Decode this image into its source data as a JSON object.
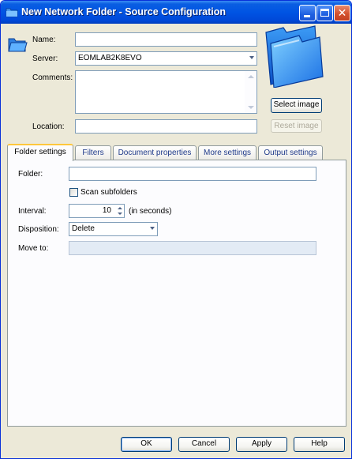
{
  "window": {
    "title": "New Network Folder - Source Configuration"
  },
  "form": {
    "name_label": "Name:",
    "name_value": "",
    "server_label": "Server:",
    "server_value": "EOMLAB2K8EVO",
    "comments_label": "Comments:",
    "comments_value": "",
    "location_label": "Location:",
    "location_value": ""
  },
  "image_panel": {
    "select_image_label": "Select image",
    "reset_image_label": "Reset image"
  },
  "tabs": [
    {
      "label": "Folder settings",
      "active": true
    },
    {
      "label": "Filters",
      "active": false
    },
    {
      "label": "Document properties",
      "active": false
    },
    {
      "label": "More settings",
      "active": false
    },
    {
      "label": "Output settings",
      "active": false
    }
  ],
  "folder_settings": {
    "folder_label": "Folder:",
    "folder_value": "",
    "scan_subfolders_label": "Scan subfolders",
    "scan_subfolders_checked": false,
    "interval_label": "Interval:",
    "interval_value": "10",
    "interval_unit": "(in seconds)",
    "disposition_label": "Disposition:",
    "disposition_value": "Delete",
    "move_to_label": "Move to:",
    "move_to_value": ""
  },
  "footer": {
    "ok_label": "OK",
    "cancel_label": "Cancel",
    "apply_label": "Apply",
    "help_label": "Help"
  },
  "colors": {
    "titlebar": "#0054e3",
    "dialog_bg": "#ece9d8",
    "active_tab_highlight": "#ffc73c"
  },
  "icons": {
    "window_icon": "network-folder-icon",
    "form_icon": "folder-icon",
    "large_preview": "folder-icon"
  }
}
